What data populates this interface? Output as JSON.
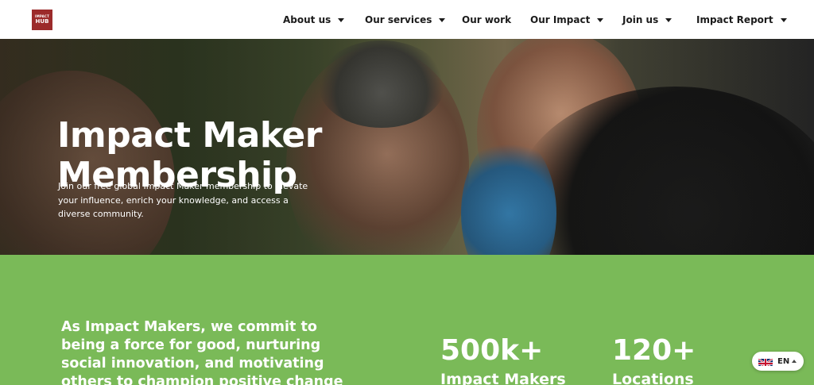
{
  "header": {
    "logo": {
      "line1": "IMPACT",
      "line2": "HUB"
    },
    "nav": [
      {
        "label": "About us",
        "has_dropdown": true
      },
      {
        "label": "Our services",
        "has_dropdown": true
      },
      {
        "label": "Our work",
        "has_dropdown": false
      },
      {
        "label": "Our Impact",
        "has_dropdown": true
      },
      {
        "label": "Join us",
        "has_dropdown": true
      },
      {
        "label": "Impact Report",
        "has_dropdown": true
      }
    ]
  },
  "hero": {
    "title_line1": "Impact Maker",
    "title_line2": "Membership",
    "text": "Join our free global Impact Maker membership to elevate your influence, enrich your knowledge, and access a diverse community."
  },
  "commitment": {
    "text": "As Impact Makers, we commit to being a force for good, nurturing social innovation, and motivating others to champion positive change"
  },
  "stats": [
    {
      "value": "500k+",
      "label": "Impact Makers"
    },
    {
      "value": "120+",
      "label": "Locations"
    }
  ],
  "language": {
    "code": "EN",
    "flag_icon": "uk-flag-icon"
  },
  "colors": {
    "brand_red": "#9c2b2b",
    "green_section": "#7aba58",
    "text_dark": "#1b1b1b"
  }
}
